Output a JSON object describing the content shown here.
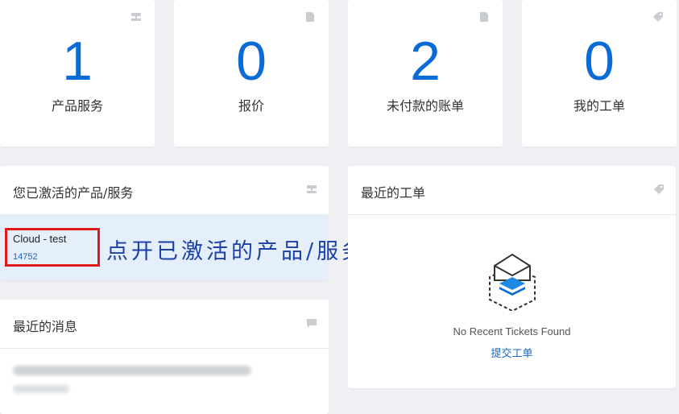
{
  "stats": [
    {
      "value": "1",
      "label": "产品服务",
      "icon": "server-icon"
    },
    {
      "value": "0",
      "label": "报价",
      "icon": "document-icon"
    },
    {
      "value": "2",
      "label": "未付款的账单",
      "icon": "document-icon"
    },
    {
      "value": "0",
      "label": "我的工单",
      "icon": "tag-icon"
    }
  ],
  "products_panel": {
    "title": "您已激活的产品/服务",
    "icon": "server-icon",
    "items": [
      {
        "name": "Cloud - test",
        "id": "14752"
      }
    ]
  },
  "annotation": {
    "text": "点开已激活的产品/服务",
    "highlight_color": "#e01919",
    "text_color": "#1b3fa8"
  },
  "tickets_panel": {
    "title": "最近的工单",
    "icon": "tag-icon",
    "empty_text": "No Recent Tickets Found",
    "submit_label": "提交工单"
  },
  "news_panel": {
    "title": "最近的消息",
    "icon": "comment-icon"
  },
  "colors": {
    "accent": "#0b6bd6",
    "link": "#1866c4",
    "background": "#eef0f3",
    "selected_row": "#e4effb"
  }
}
